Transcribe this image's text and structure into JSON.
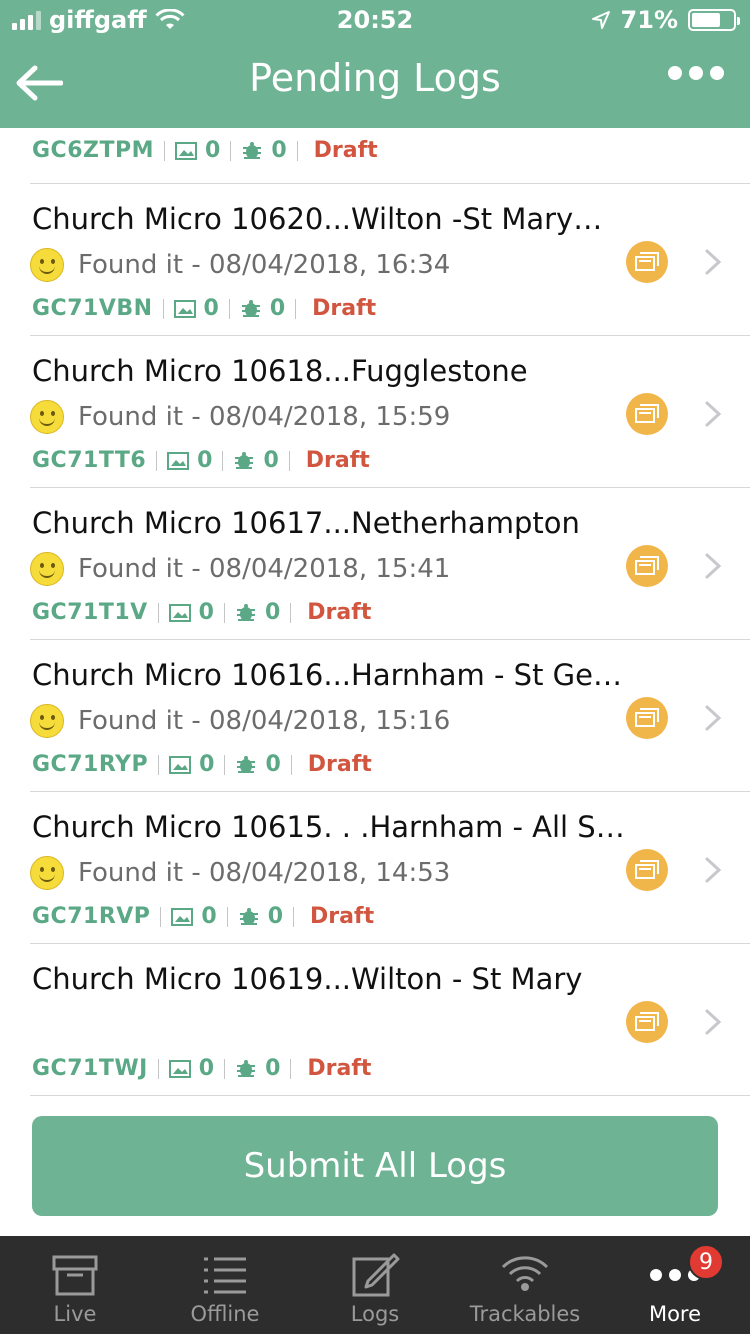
{
  "status_bar": {
    "carrier": "giffgaff",
    "time": "20:52",
    "battery": "71%",
    "battery_level": 0.71
  },
  "header": {
    "title": "Pending Logs",
    "back_icon": "arrow-left-icon",
    "more_icon": "more-dots-icon"
  },
  "partial_row": {
    "code": "GC6ZTPM",
    "images": "0",
    "trackables": "0",
    "state": "Draft"
  },
  "logs": [
    {
      "title": "Church Micro 10620...Wilton -St Mary…",
      "status": "Found it - 08/04/2018, 16:34",
      "has_smiley": true,
      "code": "GC71VBN",
      "images": "0",
      "trackables": "0",
      "state": "Draft"
    },
    {
      "title": "Church Micro 10618...Fugglestone",
      "status": "Found it - 08/04/2018, 15:59",
      "has_smiley": true,
      "code": "GC71TT6",
      "images": "0",
      "trackables": "0",
      "state": "Draft"
    },
    {
      "title": "Church Micro 10617...Netherhampton",
      "status": "Found it - 08/04/2018, 15:41",
      "has_smiley": true,
      "code": "GC71T1V",
      "images": "0",
      "trackables": "0",
      "state": "Draft"
    },
    {
      "title": "Church Micro 10616...Harnham - St Ge…",
      "status": "Found it - 08/04/2018, 15:16",
      "has_smiley": true,
      "code": "GC71RYP",
      "images": "0",
      "trackables": "0",
      "state": "Draft"
    },
    {
      "title": "Church Micro 10615. . .Harnham - All S…",
      "status": "Found it - 08/04/2018, 14:53",
      "has_smiley": true,
      "code": "GC71RVP",
      "images": "0",
      "trackables": "0",
      "state": "Draft"
    },
    {
      "title": "Church Micro 10619...Wilton - St Mary",
      "status": "",
      "has_smiley": false,
      "code": "GC71TWJ",
      "images": "0",
      "trackables": "0",
      "state": "Draft"
    }
  ],
  "submit": {
    "label": "Submit All Logs"
  },
  "tabs": [
    {
      "label": "Live",
      "icon": "box-icon",
      "active": false
    },
    {
      "label": "Offline",
      "icon": "list-icon",
      "active": false
    },
    {
      "label": "Logs",
      "icon": "edit-icon",
      "active": false
    },
    {
      "label": "Trackables",
      "icon": "signal-icon",
      "active": false
    },
    {
      "label": "More",
      "icon": "more-dots-icon",
      "active": true,
      "badge": "9"
    }
  ],
  "colors": {
    "brand_green": "#6eb394",
    "code_green": "#5aa886",
    "draft_red": "#d1553f",
    "cache_orange": "#f0b64a",
    "tabbar_bg": "#2d2d2d"
  }
}
